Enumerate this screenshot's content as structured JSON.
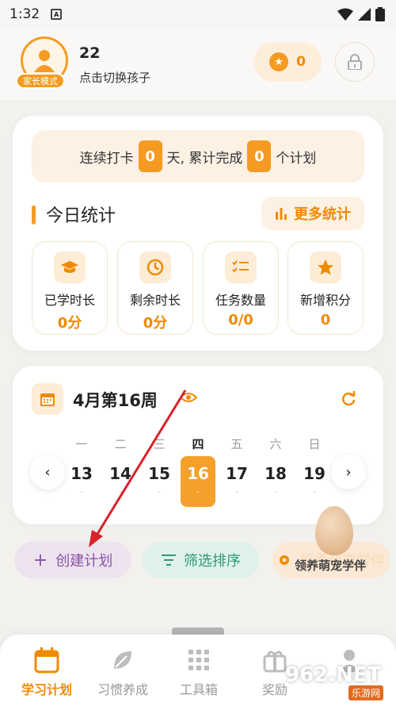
{
  "status_bar": {
    "time": "1:32",
    "notif_letter": "A"
  },
  "header": {
    "mode_badge": "家长模式",
    "child_count": "22",
    "switch_child": "点击切换孩子",
    "points": "0"
  },
  "streak": {
    "prefix": "连续打卡",
    "days": "0",
    "mid": "天, 累计完成",
    "plans": "0",
    "suffix": "个计划"
  },
  "today": {
    "title": "今日统计",
    "more_label": "更多统计",
    "tiles": [
      {
        "label": "已学时长",
        "value": "0分"
      },
      {
        "label": "剩余时长",
        "value": "0分"
      },
      {
        "label": "任务数量",
        "value": "0/0"
      },
      {
        "label": "新增积分",
        "value": "0"
      }
    ]
  },
  "week": {
    "title": "4月第16周",
    "weekdays": [
      "一",
      "二",
      "三",
      "四",
      "五",
      "六",
      "日"
    ],
    "days": [
      "13",
      "14",
      "15",
      "16",
      "17",
      "18",
      "19"
    ],
    "day_marks": [
      "-",
      "-",
      "-",
      "-",
      "-",
      "-",
      "-"
    ],
    "active_index": 3
  },
  "actions": {
    "create_plan": "创建计划",
    "filter_sort": "筛选排序",
    "third": "领养萌宠学伴"
  },
  "pet_label": "领养萌宠学伴",
  "tabs": [
    {
      "label": "学习计划",
      "icon": "calendar-icon"
    },
    {
      "label": "习惯养成",
      "icon": "leaf-icon"
    },
    {
      "label": "工具箱",
      "icon": "grid-icon"
    },
    {
      "label": "奖励",
      "icon": "gift-icon"
    },
    {
      "label": "",
      "icon": "user-icon"
    }
  ],
  "watermark": {
    "main": "962.NET",
    "sub": "乐游网"
  },
  "colors": {
    "accent": "#f59b22",
    "purple": "#8a54a8",
    "green": "#2e9a78",
    "arrow": "#d8222a"
  }
}
